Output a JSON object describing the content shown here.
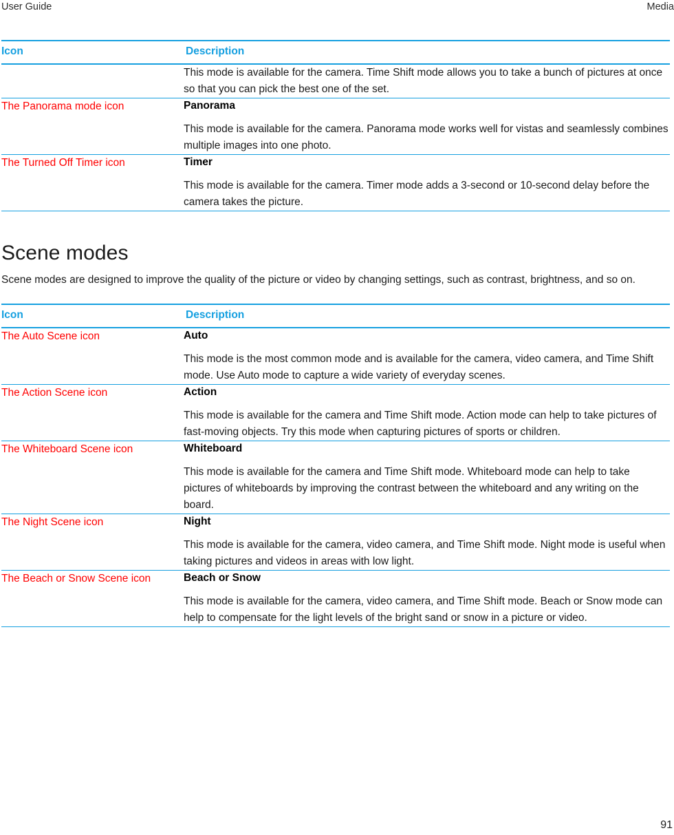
{
  "header": {
    "left_title": "User Guide",
    "right_title": "Media"
  },
  "table_one": {
    "columns": {
      "icon": "Icon",
      "description": "Description"
    },
    "rows": [
      {
        "icon_label": "",
        "title": "",
        "body": "This mode is available for the camera. Time Shift mode allows you to take a bunch of pictures at once so that you can pick the best one of the set."
      },
      {
        "icon_label": "The Panorama mode icon",
        "title": "Panorama",
        "body": "This mode is available for the camera. Panorama mode works well for vistas and seamlessly combines multiple images into one photo."
      },
      {
        "icon_label": "The Turned Off Timer icon",
        "title": "Timer",
        "body": "This mode is available for the camera. Timer mode adds a 3-second or 10-second delay before the camera takes the picture."
      }
    ]
  },
  "section": {
    "heading": "Scene modes",
    "intro": "Scene modes are designed to improve the quality of the picture or video by changing settings, such as contrast, brightness, and so on."
  },
  "table_two": {
    "columns": {
      "icon": "Icon",
      "description": "Description"
    },
    "rows": [
      {
        "icon_label": "The Auto Scene icon",
        "title": "Auto",
        "body": "This mode is the most common mode and is available for the camera, video camera, and Time Shift mode. Use Auto mode to capture a wide variety of everyday scenes."
      },
      {
        "icon_label": "The Action Scene icon",
        "title": "Action",
        "body": "This mode is available for the camera and Time Shift mode. Action mode can help to take pictures of fast-moving objects. Try this mode when capturing pictures of sports or children."
      },
      {
        "icon_label": "The Whiteboard Scene icon",
        "title": "Whiteboard",
        "body": "This mode is available for the camera and Time Shift mode. Whiteboard mode can help to take pictures of whiteboards by improving the contrast between the whiteboard and any writing on the board."
      },
      {
        "icon_label": "The Night Scene icon",
        "title": "Night",
        "body": "This mode is available for the camera, video camera, and Time Shift mode. Night mode is useful when taking pictures and videos in areas with low light."
      },
      {
        "icon_label": "The Beach or Snow Scene icon",
        "title": "Beach or Snow",
        "body": "This mode is available for the camera, video camera, and Time Shift mode. Beach or Snow mode can help to compensate for the light levels of the bright sand or snow in a picture or video."
      }
    ]
  },
  "footer": {
    "page_number": "91"
  },
  "colors": {
    "accent_blue": "#149fe0",
    "broken_image_red": "#ff0000",
    "body_text": "#1a1a1a"
  }
}
